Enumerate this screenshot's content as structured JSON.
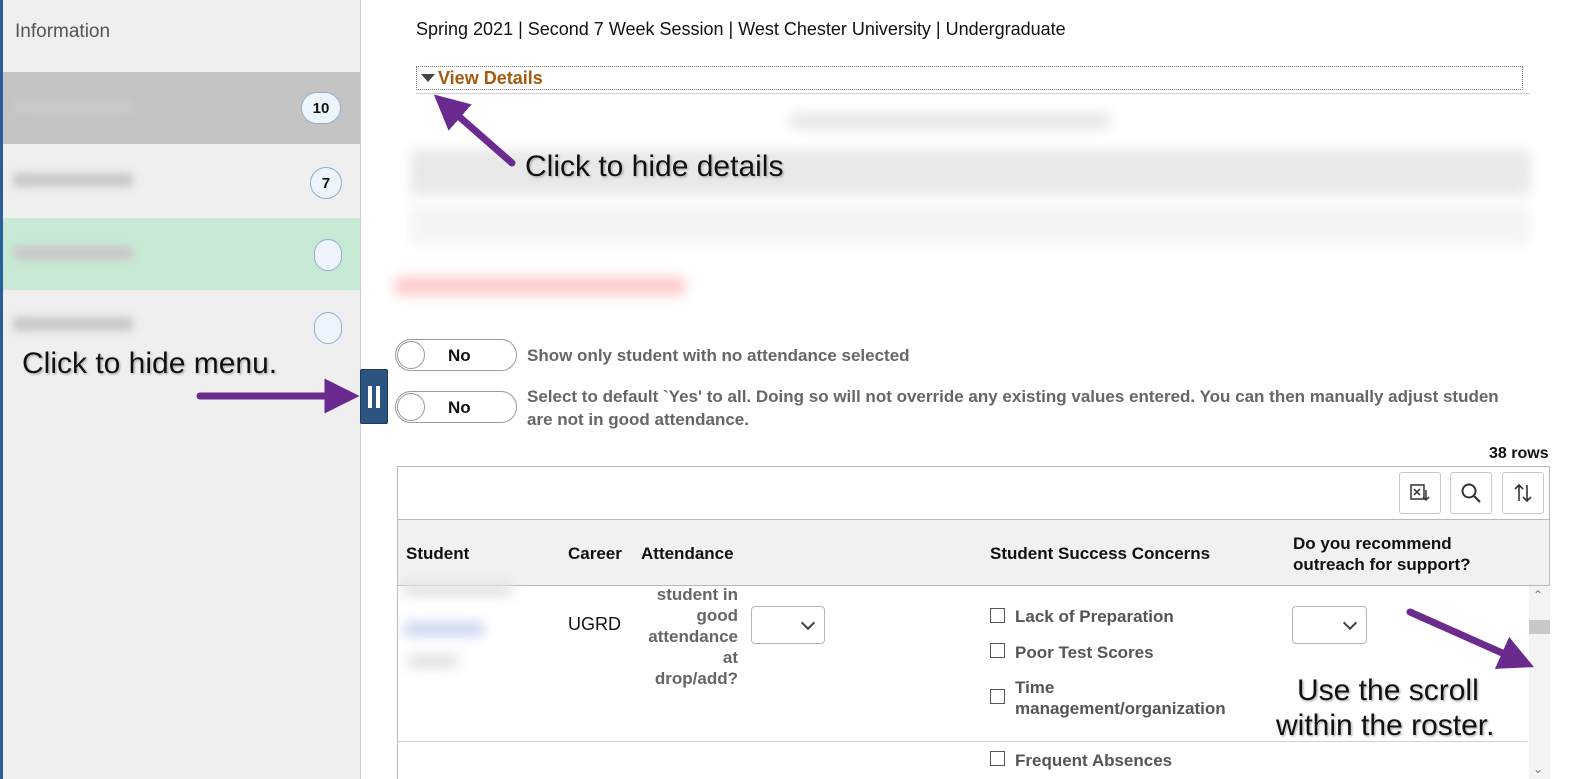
{
  "sidebar": {
    "title": "Information",
    "items": [
      {
        "badge": "10",
        "state": "selected"
      },
      {
        "badge": "7",
        "state": "normal"
      },
      {
        "badge": "",
        "state": "highlight"
      },
      {
        "badge": "",
        "state": "normal"
      }
    ]
  },
  "header": {
    "term_line": "Spring 2021 | Second 7 Week Session | West Chester University | Undergraduate",
    "view_details": "View Details"
  },
  "toggles": [
    {
      "value": "No",
      "description": "Show only student with no attendance selected"
    },
    {
      "value": "No",
      "description_line1": "Select to default `Yes' to all. Doing so will not override any existing values entered. You can then manually adjust studen",
      "description_line2": "are not in good attendance."
    }
  ],
  "grid": {
    "row_count": "38 rows",
    "toolbar_icons": [
      "export-excel-icon",
      "search-icon",
      "sort-icon"
    ],
    "columns": {
      "student": "Student",
      "career": "Career",
      "attendance": "Attendance",
      "concerns": "Student Success Concerns",
      "outreach_line1": "Do you recommend",
      "outreach_line2": "outreach for support?"
    },
    "row": {
      "career": "UGRD",
      "attendance_question": [
        "student in",
        "good",
        "attendance",
        "at",
        "drop/add?"
      ],
      "concerns": [
        "Lack of Preparation",
        "Poor Test Scores",
        "Time",
        "management/organization"
      ],
      "next_concern": "Frequent Absences"
    }
  },
  "annotations": {
    "hide_details": "Click to hide details",
    "hide_menu": "Click to hide menu.",
    "scroll_line1": "Use the scroll",
    "scroll_line2": "within the roster."
  },
  "colors": {
    "accent_link": "#a55a10",
    "annotation_arrow": "#6a2a8e",
    "handle": "#2c5480",
    "selected_item": "#c4c4c4",
    "highlight_item": "#c8ead5"
  }
}
